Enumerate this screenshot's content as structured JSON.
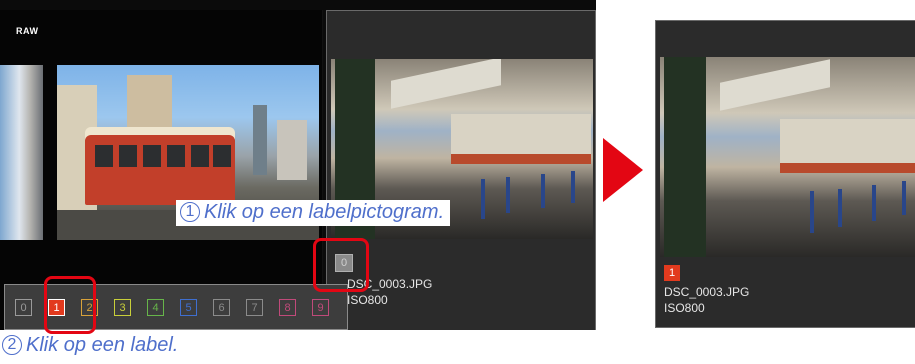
{
  "left_thumb": {
    "badge": "RAW"
  },
  "right_thumb": {
    "label_value": "0",
    "filename": "DSC_0003.JPG",
    "iso": "ISO800"
  },
  "label_bar": {
    "labels": [
      {
        "text": "0",
        "color": "#9a9a9a"
      },
      {
        "text": "1",
        "color": "#e23a1e"
      },
      {
        "text": "2",
        "color": "#d8a23a"
      },
      {
        "text": "3",
        "color": "#c9cf3a"
      },
      {
        "text": "4",
        "color": "#67b54a"
      },
      {
        "text": "5",
        "color": "#3f6fd0"
      },
      {
        "text": "6",
        "color": "#8b8b8b"
      },
      {
        "text": "7",
        "color": "#8b8b8b"
      },
      {
        "text": "8",
        "color": "#c04a7a"
      },
      {
        "text": "9",
        "color": "#c04a7a"
      }
    ],
    "selected": "1"
  },
  "callouts": {
    "step1_num": "1",
    "step1_text": "Klik op een labelpictogram.",
    "step2_num": "2",
    "step2_text": "Klik op een label."
  },
  "result": {
    "label_value": "1",
    "filename": "DSC_0003.JPG",
    "iso": "ISO800"
  },
  "colors": {
    "highlight": "#e30613",
    "callout_text": "#4f6fcb",
    "label_red": "#e23a1e"
  }
}
